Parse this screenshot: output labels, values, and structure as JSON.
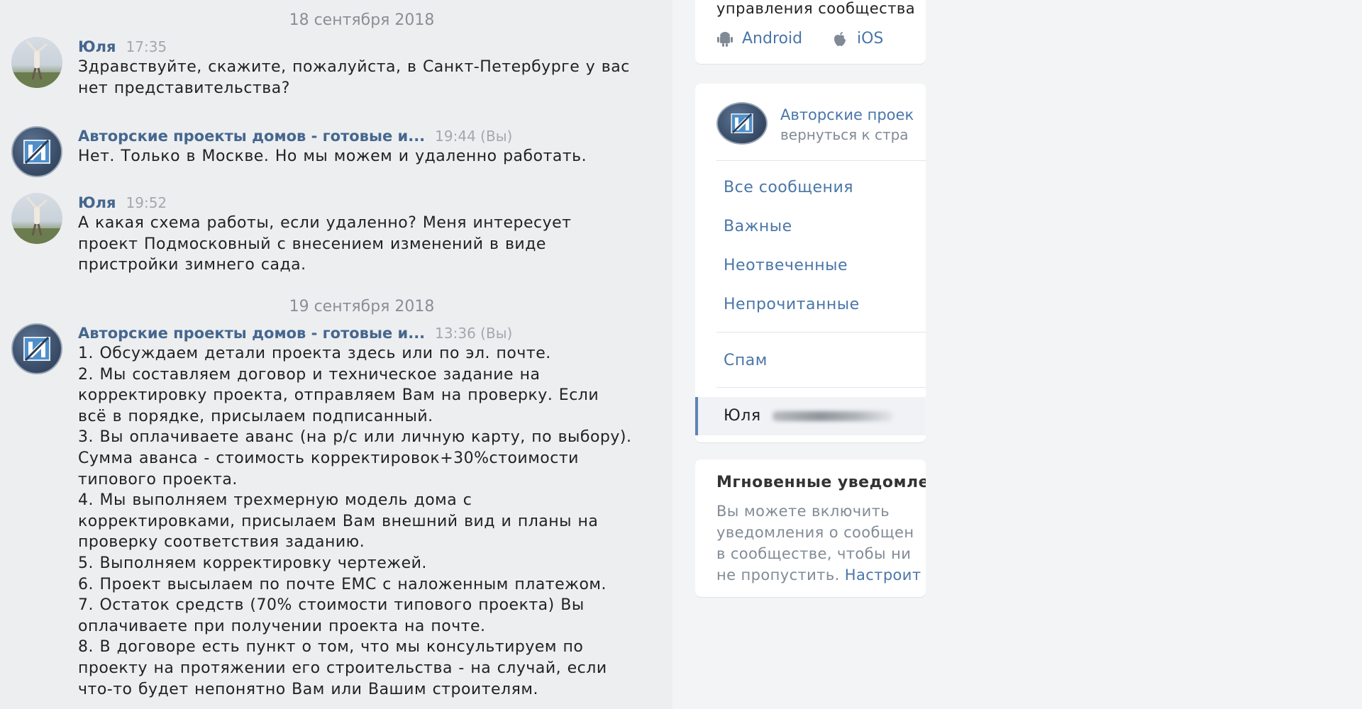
{
  "chat": {
    "date_1": "18 сентября 2018",
    "date_2": "19 сентября 2018",
    "messages": [
      {
        "author": "Юля",
        "time": "17:35",
        "text": "Здравствуйте, скажите, пожалуйста, в Санкт-Петербурге у вас\nнет представительства?"
      },
      {
        "author": "Авторские проекты домов - готовые и...",
        "time": "19:44 (Вы)",
        "text": "Нет. Только в Москве. Но мы можем и удаленно работать."
      },
      {
        "author": "Юля",
        "time": "19:52",
        "text": "А какая схема работы, если удаленно? Меня интересует\nпроект Подмосковный с внесением изменений в виде\nпристройки зимнего сада."
      },
      {
        "author": "Авторские проекты домов - готовые и...",
        "time": "13:36 (Вы)",
        "text": "1. Обсуждаем детали проекта здесь или по эл. почте.\n2. Мы составляем договор и техническое задание на\nкорректировку проекта, отправляем Вам на проверку. Если\nвсё в порядке, присылаем подписанный.\n3. Вы оплачиваете аванс (на р/с или личную карту, по выбору).\nСумма аванса - стоимость корректировок+30%стоимости\nтипового проекта.\n4. Мы выполняем трехмерную модель дома с\nкорректировками, присылаем Вам внешний вид и планы на\nпроверку соответствия заданию.\n5. Выполняем корректировку чертежей.\n6. Проект высылаем по почте ЕМС с наложенным платежом.\n7. Остаток средств (70% стоимости типового проекта) Вы\nоплачиваете при получении проекта на почте.\n8. В договоре есть пункт о том, что мы консультируем по\nпроекту на протяжении его строительства - на случай, если\nчто-то будет непонятно Вам или Вашим строителям."
      }
    ]
  },
  "side": {
    "apps_title": "управления сообщества",
    "app_android": "Android",
    "app_ios": "iOS",
    "community_name": "Авторские проек",
    "community_back": "вернуться к стра",
    "menu": {
      "all": "Все сообщения",
      "important": "Важные",
      "unanswered": "Неотвеченные",
      "unread": "Непрочитанные",
      "spam": "Спам",
      "active_chat": "Юля"
    },
    "notify_title": "Мгновенные уведомлен",
    "notify_text": "Вы можете включить\nуведомления о сообщен\nв сообществе, чтобы ни\nне пропустить. ",
    "notify_link": "Настроит"
  },
  "colors": {
    "link": "#4a76a8",
    "author": "#45678f",
    "muted": "#a3a8ae",
    "chat_bg": "#edeef0"
  },
  "icons": {
    "android": "android-icon",
    "ios": "apple-icon"
  }
}
